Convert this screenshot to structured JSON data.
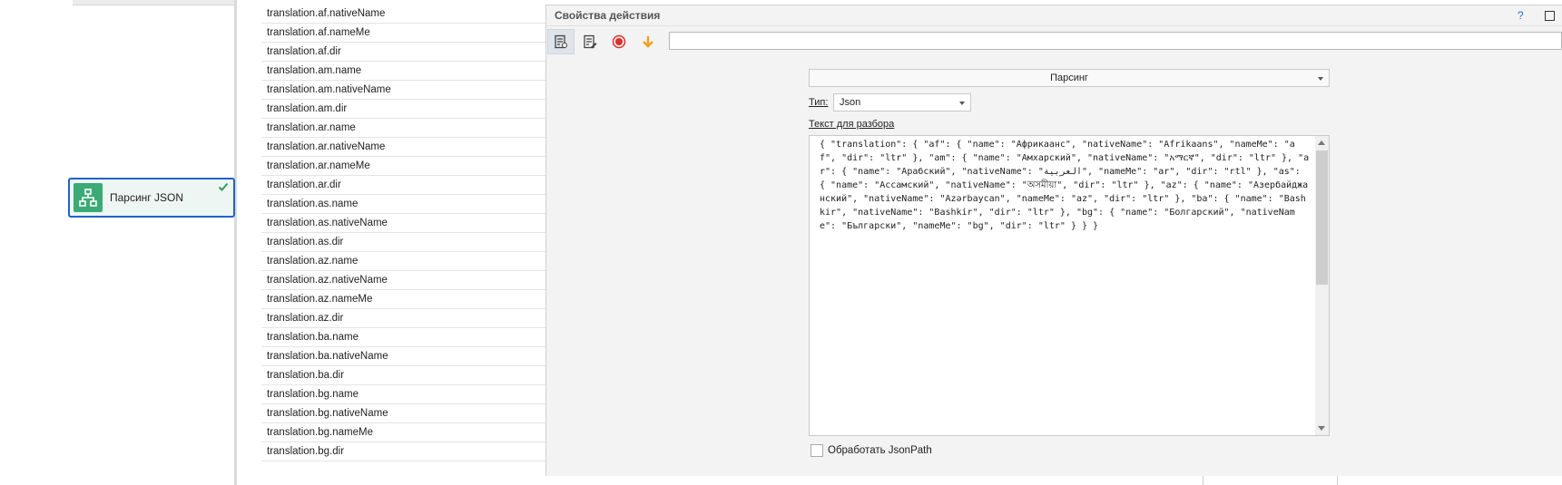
{
  "canvas": {
    "node": {
      "label": "Парсинг JSON",
      "icon": "sitemap-icon",
      "status_icon": "checkmark-icon"
    }
  },
  "variables": [
    "translation.af.nativeName",
    "translation.af.nameMe",
    "translation.af.dir",
    "translation.am.name",
    "translation.am.nativeName",
    "translation.am.dir",
    "translation.ar.name",
    "translation.ar.nativeName",
    "translation.ar.nameMe",
    "translation.ar.dir",
    "translation.as.name",
    "translation.as.nativeName",
    "translation.as.dir",
    "translation.az.name",
    "translation.az.nativeName",
    "translation.az.nameMe",
    "translation.az.dir",
    "translation.ba.name",
    "translation.ba.nativeName",
    "translation.ba.dir",
    "translation.bg.name",
    "translation.bg.nativeName",
    "translation.bg.nameMe",
    "translation.bg.dir"
  ],
  "panel": {
    "title": "Свойства действия",
    "help": "?",
    "toolbar_input_value": "",
    "mode_value": "Парсинг",
    "type_label": "Тип:",
    "type_value": "Json",
    "text_label": "Текст для разбора",
    "json_text": "{ \"translation\": { \"af\": { \"name\": \"Африкаанс\", \"nativeName\": \"Afrikaans\", \"nameMe\": \"af\", \"dir\": \"ltr\" }, \"am\": { \"name\": \"Амхарский\", \"nativeName\": \"አማርኛ\", \"dir\": \"ltr\" }, \"ar\": { \"name\": \"Арабский\", \"nativeName\": \"العربية\", \"nameMe\": \"ar\", \"dir\": \"rtl\" }, \"as\": { \"name\": \"Ассамский\", \"nativeName\": \"অসমীয়া\", \"dir\": \"ltr\" }, \"az\": { \"name\": \"Азербайджанский\", \"nativeName\": \"Azərbaycan\", \"nameMe\": \"az\", \"dir\": \"ltr\" }, \"ba\": { \"name\": \"Bashkir\", \"nativeName\": \"Bashkir\", \"dir\": \"ltr\" }, \"bg\": { \"name\": \"Болгарский\", \"nativeName\": \"Български\", \"nameMe\": \"bg\", \"dir\": \"ltr\" } } }",
    "jsonpath_label": "Обработать JsonPath",
    "jsonpath_checked": false
  },
  "colors": {
    "node_border": "#1f62c9",
    "node_icon_bg": "#3bab75",
    "record_red": "#e0302b",
    "arrow_orange": "#f0a020"
  }
}
